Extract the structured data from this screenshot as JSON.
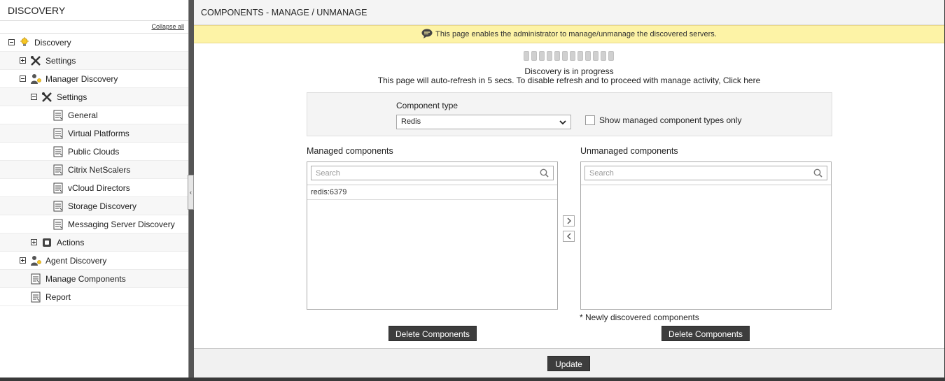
{
  "sidebar": {
    "title": "DISCOVERY",
    "collapse_all": "Collapse all",
    "items": [
      {
        "label": "Discovery"
      },
      {
        "label": "Settings"
      },
      {
        "label": "Manager Discovery"
      },
      {
        "label": "Settings"
      },
      {
        "label": "General"
      },
      {
        "label": "Virtual Platforms"
      },
      {
        "label": "Public Clouds"
      },
      {
        "label": "Citrix NetScalers"
      },
      {
        "label": "vCloud Directors"
      },
      {
        "label": "Storage Discovery"
      },
      {
        "label": "Messaging Server Discovery"
      },
      {
        "label": "Actions"
      },
      {
        "label": "Agent Discovery"
      },
      {
        "label": "Manage Components"
      },
      {
        "label": "Report"
      }
    ]
  },
  "main": {
    "title": "COMPONENTS - MANAGE / UNMANAGE",
    "notice": "This page enables the administrator to manage/unmanage the discovered servers.",
    "status_line1": "Discovery is in progress",
    "status_line2_prefix": "This page will auto-refresh in 5 secs. To disable refresh and to proceed with manage activity, ",
    "status_line2_link": "Click here",
    "component_type_label": "Component type",
    "component_type_value": "Redis",
    "managed_only_label": "Show managed component types only",
    "managed_title": "Managed components",
    "unmanaged_title": "Unmanaged components",
    "search_placeholder": "Search",
    "managed_items": [
      "redis:6379"
    ],
    "unmanaged_items": [],
    "newly_discovered_note": "* Newly discovered components",
    "delete_button": "Delete Components",
    "update_button": "Update"
  },
  "colors": {
    "notice_bg": "#fdf3a6",
    "button_bg": "#3d3d3d"
  }
}
